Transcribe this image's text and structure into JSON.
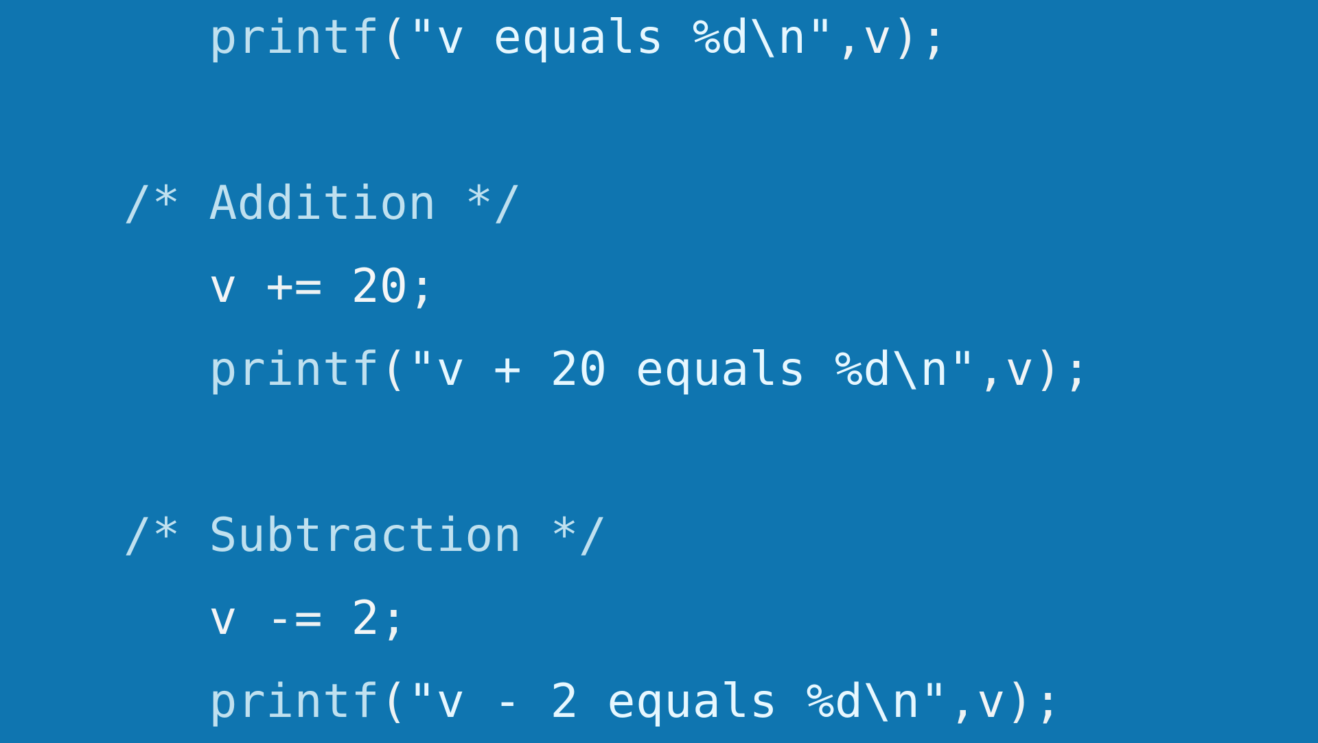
{
  "lines": {
    "l1_indent": "   ",
    "l1_fn": "printf",
    "l1_open": "(",
    "l1_q1": "\"",
    "l1_str": "v equals %d",
    "l1_esc": "\\n",
    "l1_q2": "\"",
    "l1_comma": ",",
    "l1_arg": "v",
    "l1_close": ")",
    "l1_semi": ";",
    "l3_cmt": "/* Addition */",
    "l4_indent": "   ",
    "l4_ident": "v",
    "l4_sp1": " ",
    "l4_op": "+=",
    "l4_sp2": " ",
    "l4_num": "20",
    "l4_semi": ";",
    "l5_indent": "   ",
    "l5_fn": "printf",
    "l5_open": "(",
    "l5_q1": "\"",
    "l5_str": "v + 20 equals %d",
    "l5_esc": "\\n",
    "l5_q2": "\"",
    "l5_comma": ",",
    "l5_arg": "v",
    "l5_close": ")",
    "l5_semi": ";",
    "l7_cmt": "/* Subtraction */",
    "l8_indent": "   ",
    "l8_ident": "v",
    "l8_sp1": " ",
    "l8_op": "-=",
    "l8_sp2": " ",
    "l8_num": "2",
    "l8_semi": ";",
    "l9_indent": "   ",
    "l9_fn": "printf",
    "l9_open": "(",
    "l9_q1": "\"",
    "l9_str": "v - 2 equals %d",
    "l9_esc": "\\n",
    "l9_q2": "\"",
    "l9_comma": ",",
    "l9_arg": "v",
    "l9_close": ")",
    "l9_semi": ";"
  }
}
